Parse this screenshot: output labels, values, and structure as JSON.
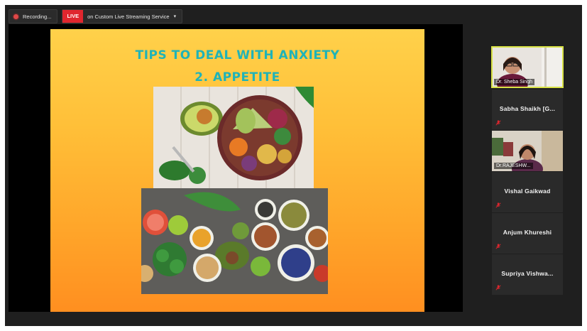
{
  "recording": {
    "label": "Recording..."
  },
  "live": {
    "badge": "LIVE",
    "label": "on Custom Live Streaming Service"
  },
  "slide": {
    "title_line1": "TIPS TO DEAL WITH ANXIETY",
    "title_line2": "2. APPETITE"
  },
  "participants": [
    {
      "name": "Dr. Sheba Singh",
      "video": true,
      "active": true
    },
    {
      "name": "Sabha  Shaikh  [G...",
      "video": false
    },
    {
      "name": "Dr.RAJESHW...",
      "video": true
    },
    {
      "name": "Vishal Gaikwad",
      "video": false
    },
    {
      "name": "Anjum Khureshi",
      "video": false
    },
    {
      "name": "Supriya  Vishwa...",
      "video": false
    }
  ],
  "colors": {
    "live": "#e0262e",
    "title": "#1fb3b8",
    "active_border": "#d8e245",
    "muted_icon": "#e0262e"
  },
  "icons": {
    "mute": "microphone-muted-icon",
    "recording": "record-dot-icon",
    "dropdown": "chevron-down-icon"
  }
}
